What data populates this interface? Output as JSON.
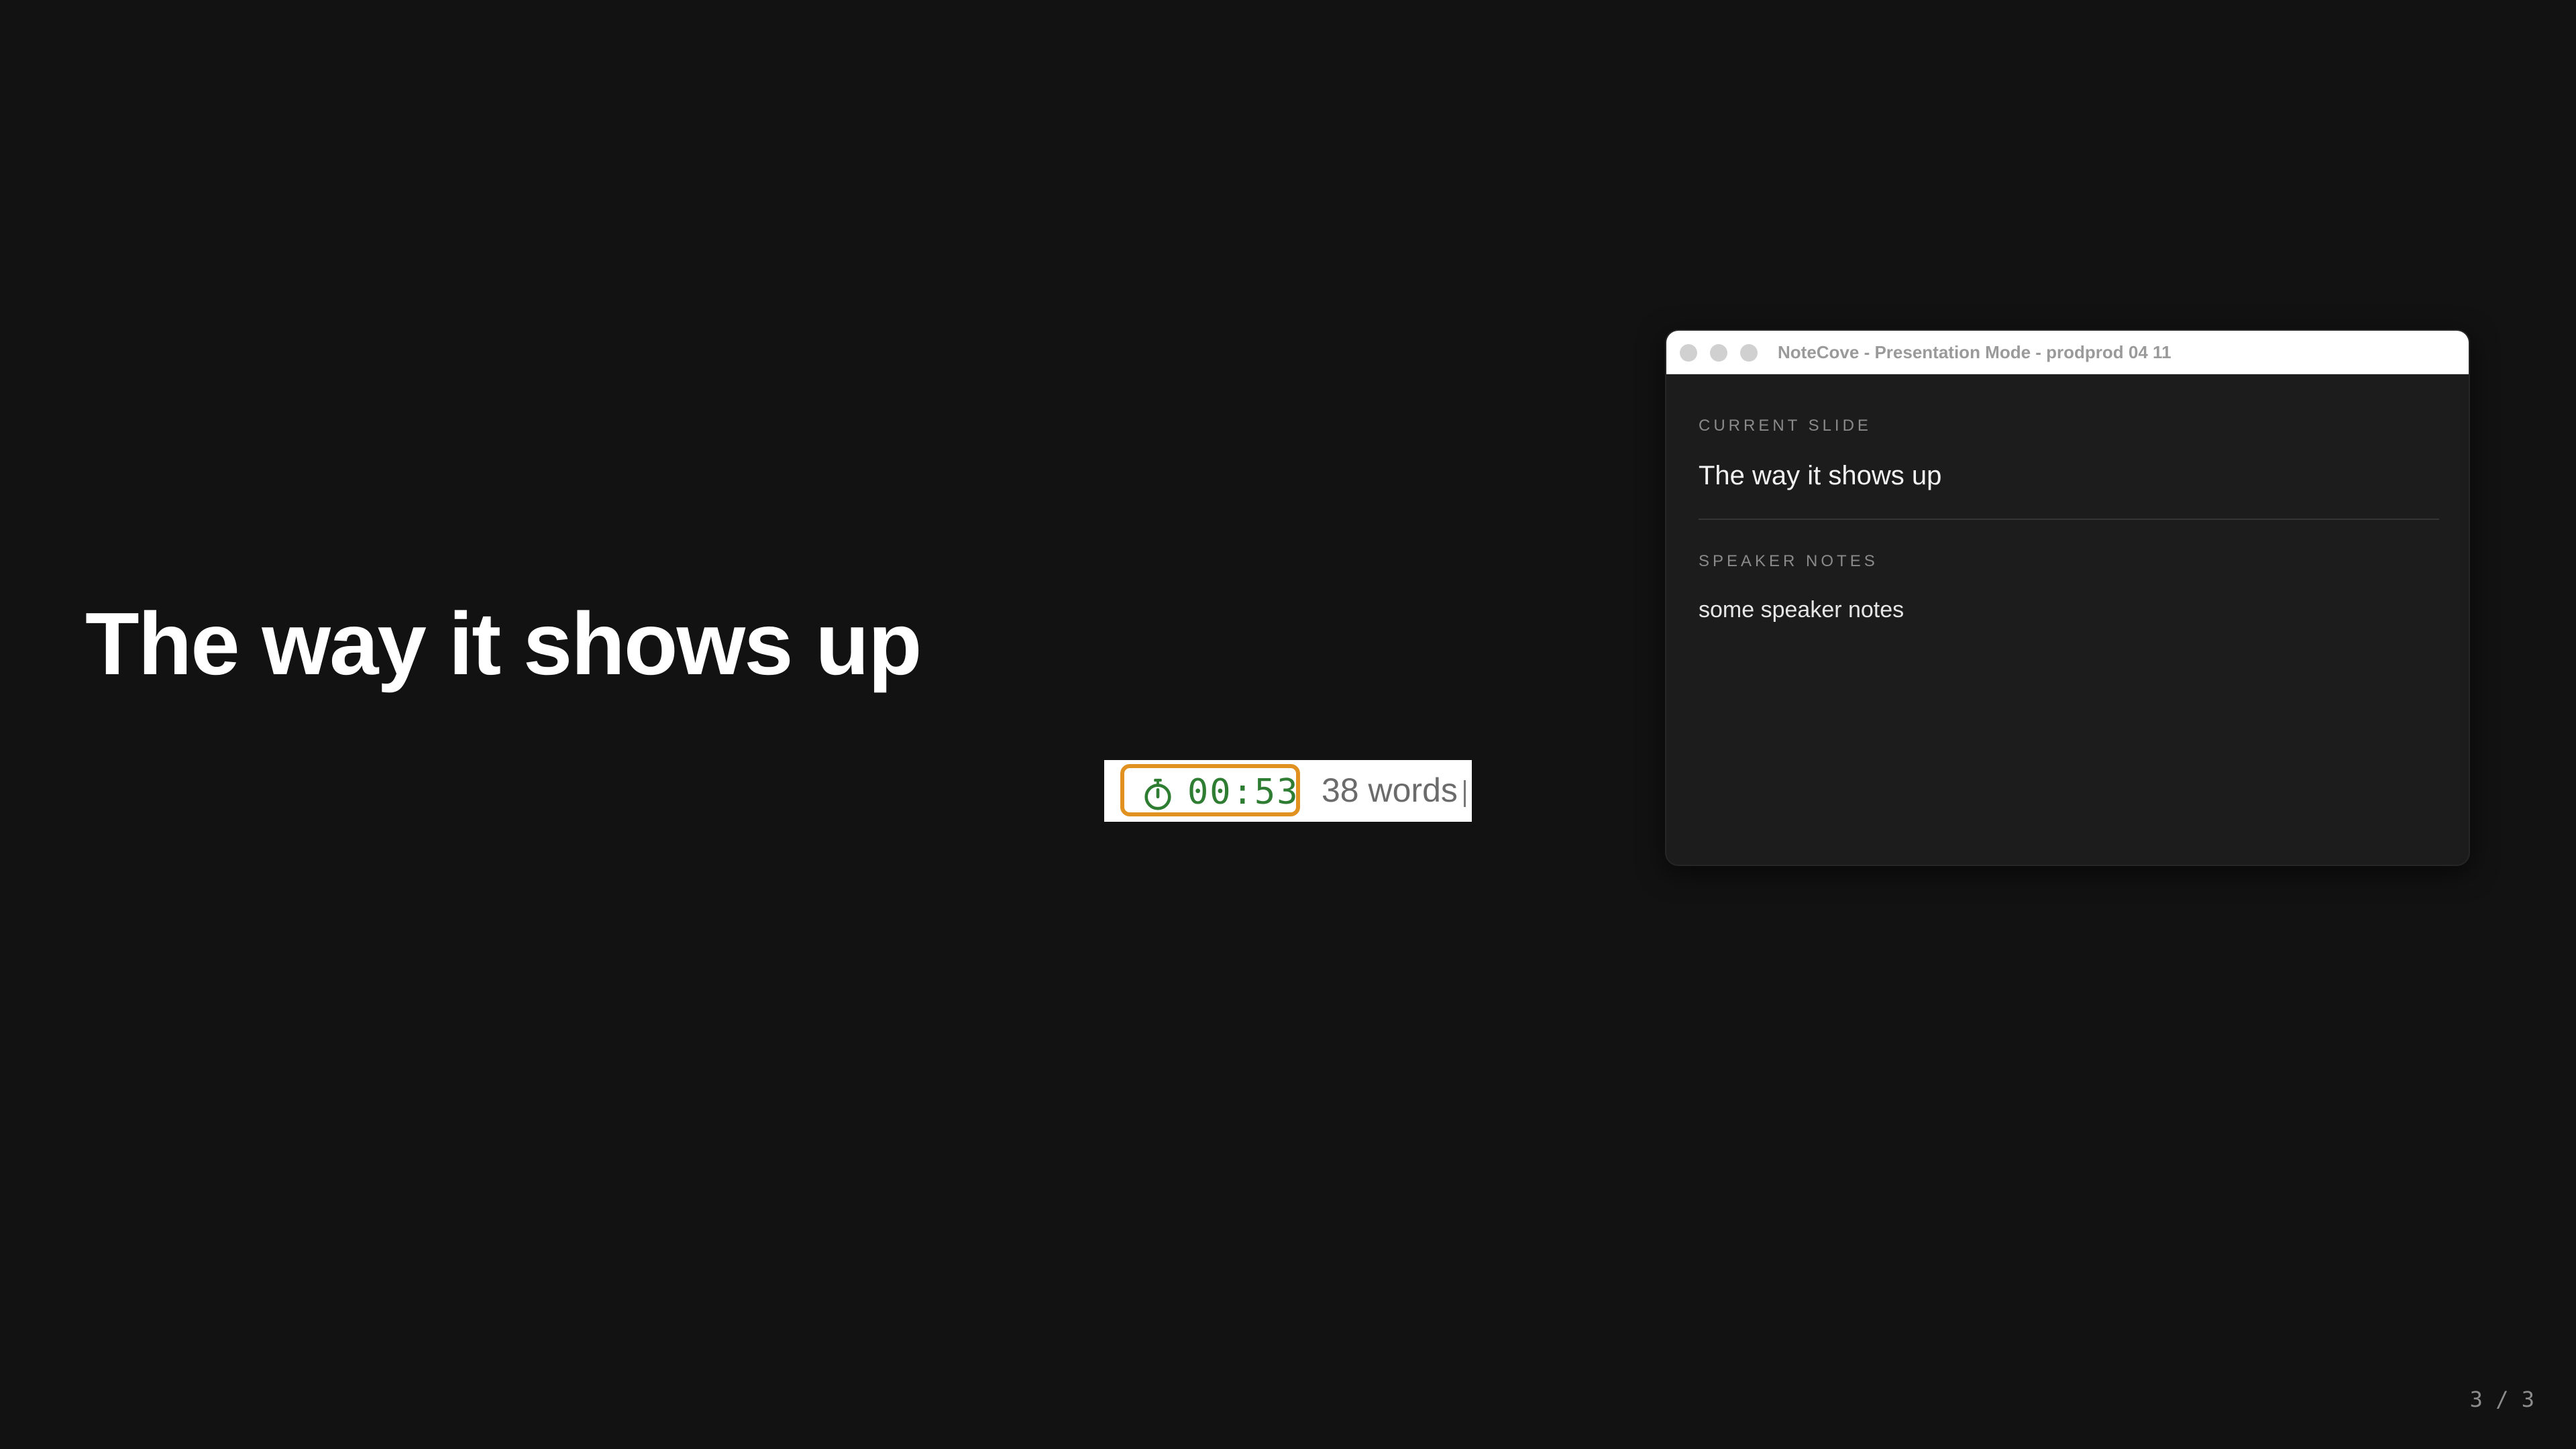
{
  "slide": {
    "title": "The way it shows up"
  },
  "timer_widget": {
    "icon": "stopwatch-icon",
    "elapsed": "00:53",
    "word_count": "38 words",
    "colors": {
      "timer_border": "#e0911f",
      "timer_text": "#2e7d32"
    }
  },
  "presenter_window": {
    "title": "NoteCove - Presentation Mode - prodprod 04 11",
    "current_slide_label": "CURRENT SLIDE",
    "current_slide_title": "The way it shows up",
    "speaker_notes_label": "SPEAKER NOTES",
    "speaker_notes": "some speaker notes"
  },
  "slide_counter": "3 / 3",
  "theme": {
    "background": "#121212"
  }
}
